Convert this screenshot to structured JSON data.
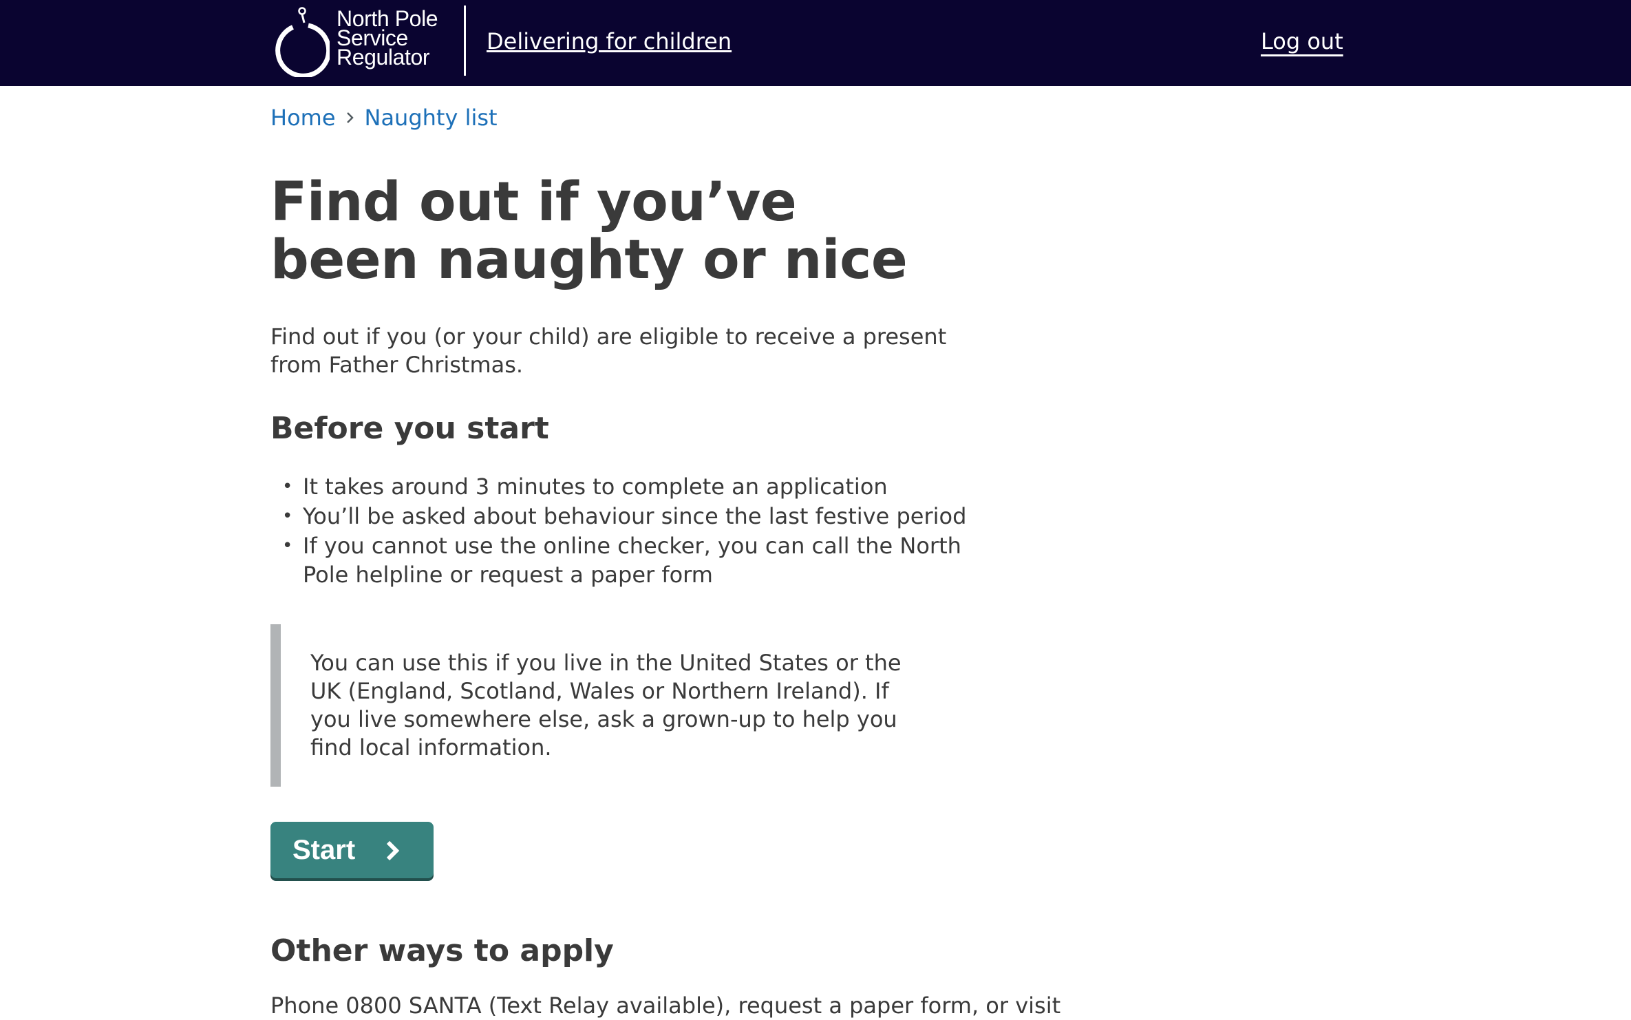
{
  "header": {
    "logo_lines": [
      "North Pole",
      "Service",
      "Regulator"
    ],
    "service_name": "Delivering for children",
    "logout_label": "Log out",
    "background_color": "#0a0430"
  },
  "breadcrumb": {
    "items": [
      "Home",
      "Naughty list"
    ]
  },
  "main": {
    "title": "Find out if you’ve been naughty or nice",
    "lead": "Find out if you (or your child) are eligible to receive a present from Father Christmas.",
    "before_heading": "Before you start",
    "bullets": [
      "It takes around 3 minutes to complete an application",
      "You’ll be asked about behaviour since the last festive period",
      "If you cannot use the online checker, you can call the North Pole helpline or request a paper form"
    ],
    "inset_text": "You can use this if you live in the United States or the UK (England, Scotland, Wales or Northern Ireland). If you live somewhere else, ask a grown-up to help you find local information.",
    "start_label": "Start",
    "start_color": "#38837f",
    "other_heading": "Other ways to apply",
    "other_text": "Phone 0800 SANTA (Text Relay available), request a paper form, or visit"
  },
  "icons": {
    "logo": "north-pole-ring-logo",
    "breadcrumb_separator": "chevron-right-icon",
    "start": "chevron-right-icon"
  }
}
